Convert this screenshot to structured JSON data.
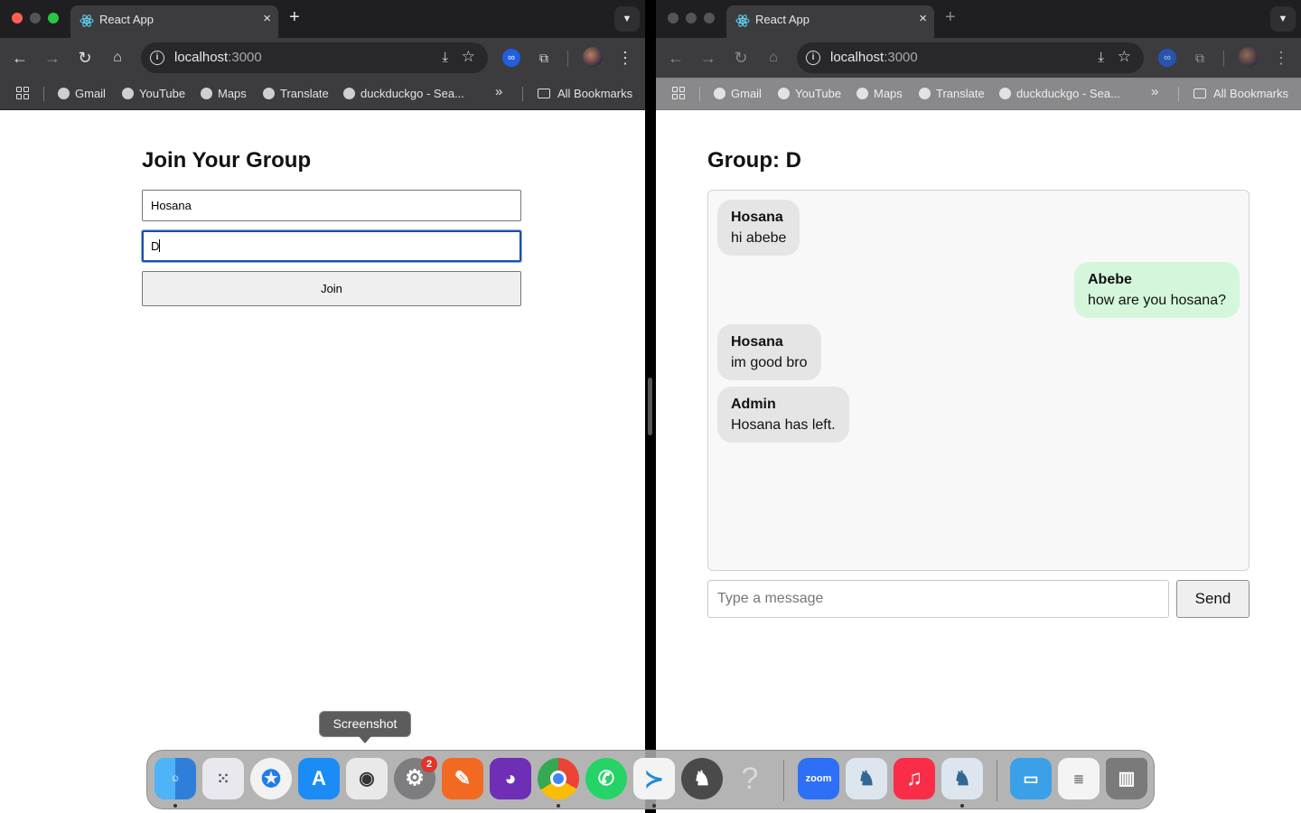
{
  "left_window": {
    "tab": {
      "title": "React App",
      "close": "×"
    },
    "new_tab": "+",
    "omnibox": {
      "host": "localhost",
      "port": ":3000"
    },
    "bookmarks": [
      "Gmail",
      "YouTube",
      "Maps",
      "Translate",
      "duckduckgo - Sea..."
    ],
    "more_bookmarks": "»",
    "all_bookmarks": "All Bookmarks",
    "page": {
      "title": "Join Your Group",
      "name_value": "Hosana",
      "group_value": "D",
      "join_label": "Join"
    }
  },
  "right_window": {
    "tab": {
      "title": "React App",
      "close": "×"
    },
    "new_tab": "+",
    "omnibox": {
      "host": "localhost",
      "port": ":3000"
    },
    "bookmarks": [
      "Gmail",
      "YouTube",
      "Maps",
      "Translate",
      "duckduckgo - Sea..."
    ],
    "more_bookmarks": "»",
    "all_bookmarks": "All Bookmarks",
    "page": {
      "title": "Group: D",
      "messages": [
        {
          "author": "Hosana",
          "text": "hi abebe",
          "side": "other"
        },
        {
          "author": "Abebe",
          "text": "how are you hosana?",
          "side": "self"
        },
        {
          "author": "Hosana",
          "text": "im good bro",
          "side": "other"
        },
        {
          "author": "Admin",
          "text": "Hosana has left.",
          "side": "other"
        }
      ],
      "message_placeholder": "Type a message",
      "send_label": "Send"
    }
  },
  "dock": {
    "tooltip": "Screenshot",
    "settings_badge": "2",
    "zoom_label": "zoom",
    "help_glyph": "?"
  },
  "colors": {
    "tab_bg": "#3c3c3f",
    "chrome_bg": "#1f1f22",
    "self_bubble": "#d4f7dc",
    "other_bubble": "#e5e5e5",
    "focus_ring": "#1a4fb0"
  }
}
